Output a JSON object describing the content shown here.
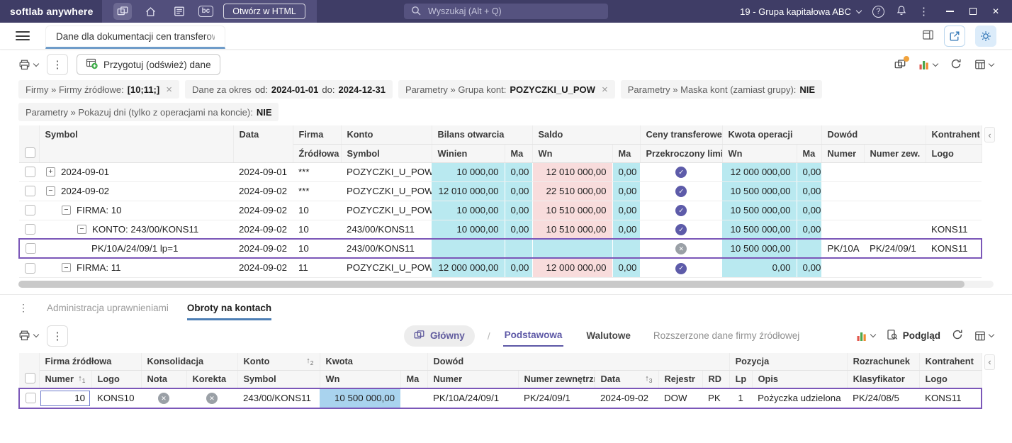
{
  "topbar": {
    "logo": "softlab anywhere",
    "bc_badge": "bc",
    "open_html": "Otwórz w HTML",
    "search_placeholder": "Wyszukaj (Alt + Q)",
    "company": "19 - Grupa kapitałowa ABC"
  },
  "tabbar": {
    "main_tab": "Dane dla dokumentacji cen transferow"
  },
  "toolbar": {
    "prepare": "Przygotuj (odśwież) dane"
  },
  "filters": {
    "f1_label": "Firmy » Firmy źródłowe:",
    "f1_value": "[10;11;]",
    "f2_label": "Dane za okres",
    "f2_od": "od:",
    "f2_od_value": "2024-01-01",
    "f2_do": "do:",
    "f2_do_value": "2024-12-31",
    "f3_label": "Parametry » Grupa kont:",
    "f3_value": "POZYCZKI_U_POW",
    "f4_label": "Parametry » Maska kont (zamiast grupy):",
    "f4_value": "NIE",
    "f5_label": "Parametry » Pokazuj dni (tylko z operacjami na koncie):",
    "f5_value": "NIE"
  },
  "main": {
    "headers": {
      "symbol": "Symbol",
      "data": "Data",
      "firma": "Firma",
      "firma_sub": "Źródłowa",
      "konto": "Konto",
      "konto_sub": "Symbol",
      "bilans": "Bilans otwarcia",
      "winien": "Winien",
      "ma1": "Ma",
      "saldo": "Saldo",
      "wn1": "Wn",
      "ma2": "Ma",
      "ceny": "Ceny transferowe",
      "limit": "Przekroczony limit",
      "kwota": "Kwota operacji",
      "wn2": "Wn",
      "ma3": "Ma",
      "dowod": "Dowód",
      "numer": "Numer",
      "numer_zew": "Numer zew.",
      "kontrahent": "Kontrahent",
      "logo": "Logo"
    },
    "rows": [
      {
        "sym": "2024-09-01",
        "data": "2024-09-01",
        "firma": "***",
        "konto": "POZYCZKI_U_POW",
        "bw": "10 000,00",
        "bm": "0,00",
        "sw": "12 010 000,00",
        "sm": "0,00",
        "limit_icon": "check-circle",
        "kw": "12 000 000,00",
        "km": "0,00",
        "dn": "",
        "dz": "",
        "logo": ""
      },
      {
        "sym": "2024-09-02",
        "data": "2024-09-02",
        "firma": "***",
        "konto": "POZYCZKI_U_POW",
        "bw": "12 010 000,00",
        "bm": "0,00",
        "sw": "22 510 000,00",
        "sm": "0,00",
        "limit_icon": "check-circle",
        "kw": "10 500 000,00",
        "km": "0,00",
        "dn": "",
        "dz": "",
        "logo": ""
      },
      {
        "sym": "FIRMA: 10",
        "data": "2024-09-02",
        "firma": "10",
        "konto": "POZYCZKI_U_POW",
        "bw": "10 000,00",
        "bm": "0,00",
        "sw": "10 510 000,00",
        "sm": "0,00",
        "limit_icon": "check-circle",
        "kw": "10 500 000,00",
        "km": "0,00",
        "dn": "",
        "dz": "",
        "logo": ""
      },
      {
        "sym": "KONTO: 243/00/KONS11",
        "data": "2024-09-02",
        "firma": "10",
        "konto": "243/00/KONS11",
        "bw": "10 000,00",
        "bm": "0,00",
        "sw": "10 510 000,00",
        "sm": "0,00",
        "limit_icon": "check-circle",
        "kw": "10 500 000,00",
        "km": "0,00",
        "dn": "",
        "dz": "",
        "logo": "KONS11"
      },
      {
        "sym": "PK/10A/24/09/1 lp=1",
        "data": "2024-09-02",
        "firma": "10",
        "konto": "243/00/KONS11",
        "bw": "",
        "bm": "",
        "sw": "",
        "sm": "",
        "limit_icon": "x-circle",
        "kw": "10 500 000,00",
        "km": "",
        "dn": "PK/10A",
        "dz": "PK/24/09/1",
        "logo": "KONS11"
      },
      {
        "sym": "FIRMA: 11",
        "data": "2024-09-02",
        "firma": "11",
        "konto": "POZYCZKI_U_POW",
        "bw": "12 000 000,00",
        "bm": "0,00",
        "sw": "12 000 000,00",
        "sm": "0,00",
        "limit_icon": "check-circle",
        "kw": "0,00",
        "km": "0,00",
        "dn": "",
        "dz": "",
        "logo": ""
      }
    ]
  },
  "bottom": {
    "tabs": {
      "t1": "Administracja uprawnieniami",
      "t2": "Obroty na kontach"
    },
    "toolbar": {
      "glowny": "Główny",
      "slash": "/",
      "view1": "Podstawowa",
      "view2": "Walutowe",
      "view3": "Rozszerzone dane firmy źródłowej",
      "podglad": "Podgląd"
    },
    "headers": {
      "firma_zrodlowa": "Firma źródłowa",
      "numer1": "Numer",
      "logo1": "Logo",
      "konsolidacja": "Konsolidacja",
      "nota": "Nota",
      "korekta": "Korekta",
      "konto": "Konto",
      "symbol": "Symbol",
      "kwota": "Kwota",
      "wn": "Wn",
      "ma": "Ma",
      "dowod": "Dowód",
      "numer2": "Numer",
      "numer_zew": "Numer zewnętrzny",
      "data": "Data",
      "rejestr": "Rejestr",
      "rd": "RD",
      "pozycja": "Pozycja",
      "lp": "Lp",
      "opis": "Opis",
      "rozrachunek": "Rozrachunek",
      "klasyfikator": "Klasyfikator",
      "kontrahent": "Kontrahent",
      "logo2": "Logo"
    },
    "sort": {
      "s1": "1",
      "s2": "2",
      "s3": "3"
    },
    "row": {
      "numer": "10",
      "logo": "KONS10",
      "nota_icon": "x-circle",
      "korekta_icon": "x-circle",
      "symbol": "243/00/KONS11",
      "wn": "10 500 000,00",
      "ma": "",
      "dowod_numer": "PK/10A/24/09/1",
      "numer_zew": "PK/24/09/1",
      "data": "2024-09-02",
      "rejestr": "DOW",
      "rd": "PK",
      "lp": "1",
      "opis": "Pożyczka udzielona",
      "klasyfikator": "PK/24/08/5",
      "kontrahent_logo": "KONS11"
    }
  },
  "colors": {
    "topbar": "#3f3d66",
    "accent_purple": "#5d5ba9",
    "selection_border": "#7b57b8",
    "cell_cyan": "#b9e9f0",
    "cell_pink": "#f8dcdc",
    "cell_selected_blue": "#a9d3ee",
    "notification_orange": "#f2a33c",
    "tab_underline_blue": "#4d7fb5"
  }
}
